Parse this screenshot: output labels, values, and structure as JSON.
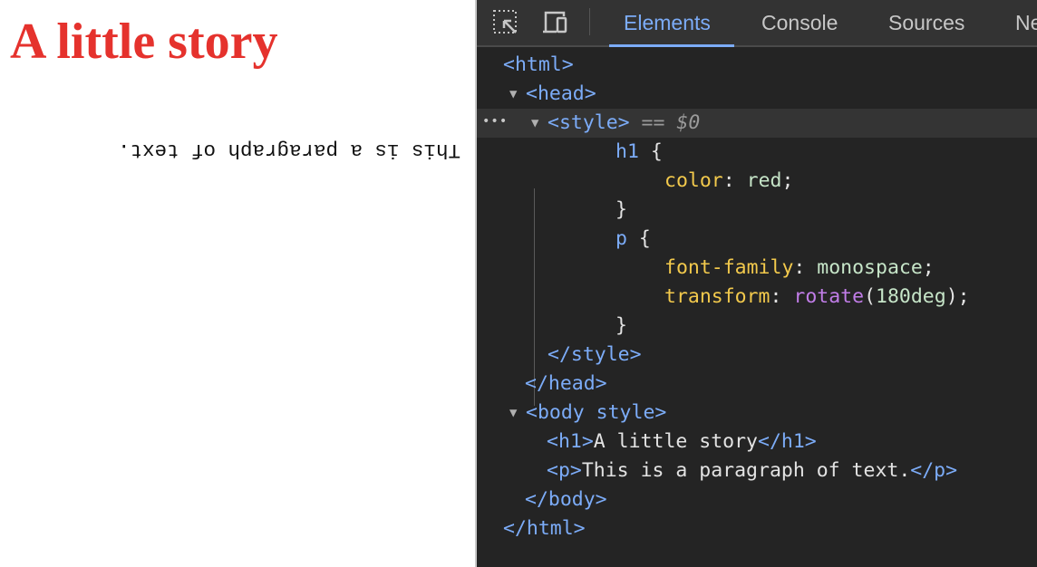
{
  "page": {
    "heading": "A little story",
    "paragraph": "This is a paragraph of text."
  },
  "devtools": {
    "tabs": [
      "Elements",
      "Console",
      "Sources",
      "Ne"
    ],
    "active_tab": "Elements",
    "icons": [
      "inspect-element-icon",
      "device-toolbar-icon"
    ],
    "colors": {
      "tag": "#7cacf8",
      "accent": "#7cacf8",
      "property": "#f2c94c",
      "value": "#c6e5c8",
      "function": "#c17de8"
    },
    "selected_suffix": "== $0",
    "lines": [
      {
        "indent": 555,
        "segments": [
          {
            "t": "tag",
            "text": "<html>"
          }
        ]
      },
      {
        "indent": 580,
        "toggle": "▼",
        "segments": [
          {
            "t": "tag",
            "text": "<head>"
          }
        ]
      },
      {
        "indent": 604,
        "toggle": "▼",
        "selected": true,
        "segments": [
          {
            "t": "tag",
            "text": "<style>"
          },
          {
            "t": "eq",
            "text": " == "
          },
          {
            "t": "eqi",
            "text": "$0"
          }
        ]
      },
      {
        "indent": 679,
        "segments": [
          {
            "t": "tag",
            "text": "h1"
          },
          {
            "t": "txt",
            "text": " {"
          }
        ]
      },
      {
        "indent": 733,
        "segments": [
          {
            "t": "prop",
            "text": "color"
          },
          {
            "t": "txt",
            "text": ": "
          },
          {
            "t": "val",
            "text": "red"
          },
          {
            "t": "txt",
            "text": ";"
          }
        ]
      },
      {
        "indent": 679,
        "segments": [
          {
            "t": "txt",
            "text": "}"
          }
        ]
      },
      {
        "indent": 679,
        "segments": [
          {
            "t": "tag",
            "text": "p"
          },
          {
            "t": "txt",
            "text": " {"
          }
        ]
      },
      {
        "indent": 733,
        "segments": [
          {
            "t": "prop",
            "text": "font-family"
          },
          {
            "t": "txt",
            "text": ": "
          },
          {
            "t": "val",
            "text": "monospace"
          },
          {
            "t": "txt",
            "text": ";"
          }
        ]
      },
      {
        "indent": 733,
        "segments": [
          {
            "t": "prop",
            "text": "transform"
          },
          {
            "t": "txt",
            "text": ": "
          },
          {
            "t": "fn",
            "text": "rotate"
          },
          {
            "t": "txt",
            "text": "("
          },
          {
            "t": "val",
            "text": "180deg"
          },
          {
            "t": "txt",
            "text": ");"
          }
        ]
      },
      {
        "indent": 679,
        "segments": [
          {
            "t": "txt",
            "text": "}"
          }
        ]
      },
      {
        "indent": 604,
        "segments": [
          {
            "t": "tag",
            "text": "</style>"
          }
        ]
      },
      {
        "indent": 579,
        "segments": [
          {
            "t": "tag",
            "text": "</head>"
          }
        ]
      },
      {
        "indent": 580,
        "toggle": "▼",
        "segments": [
          {
            "t": "tag",
            "text": "<body style>"
          }
        ]
      },
      {
        "indent": 603,
        "segments": [
          {
            "t": "tag",
            "text": "<h1>"
          },
          {
            "t": "txt",
            "text": "A little story"
          },
          {
            "t": "tag",
            "text": "</h1>"
          }
        ]
      },
      {
        "indent": 603,
        "segments": [
          {
            "t": "tag",
            "text": "<p>"
          },
          {
            "t": "txt",
            "text": "This is a paragraph of text."
          },
          {
            "t": "tag",
            "text": "</p>"
          }
        ]
      },
      {
        "indent": 579,
        "segments": [
          {
            "t": "tag",
            "text": "</body>"
          }
        ]
      },
      {
        "indent": 555,
        "segments": [
          {
            "t": "tag",
            "text": "</html>"
          }
        ]
      }
    ]
  }
}
